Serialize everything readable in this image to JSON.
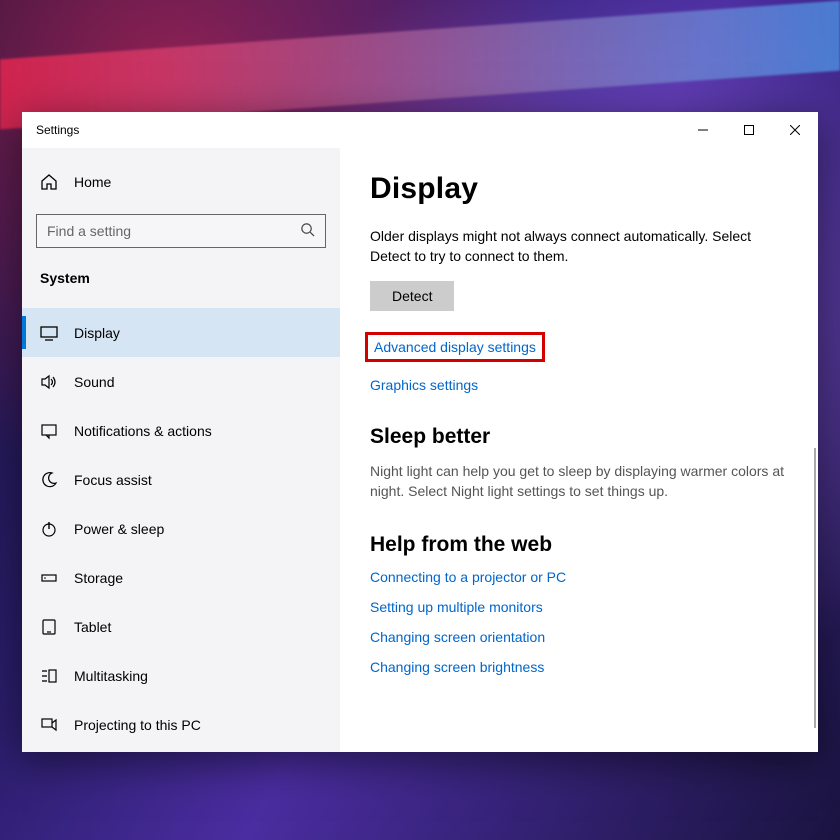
{
  "window": {
    "title": "Settings"
  },
  "sidebar": {
    "home": "Home",
    "search_placeholder": "Find a setting",
    "section": "System",
    "items": [
      {
        "label": "Display",
        "icon": "monitor",
        "selected": true
      },
      {
        "label": "Sound",
        "icon": "sound"
      },
      {
        "label": "Notifications & actions",
        "icon": "notification"
      },
      {
        "label": "Focus assist",
        "icon": "moon"
      },
      {
        "label": "Power & sleep",
        "icon": "power"
      },
      {
        "label": "Storage",
        "icon": "storage"
      },
      {
        "label": "Tablet",
        "icon": "tablet"
      },
      {
        "label": "Multitasking",
        "icon": "multitask"
      },
      {
        "label": "Projecting to this PC",
        "icon": "project"
      }
    ]
  },
  "main": {
    "heading": "Display",
    "older_text": "Older displays might not always connect automatically. Select Detect to try to connect to them.",
    "detect": "Detect",
    "adv_link": "Advanced display settings",
    "gfx_link": "Graphics settings",
    "sleep_heading": "Sleep better",
    "sleep_desc": "Night light can help you get to sleep by displaying warmer colors at night. Select Night light settings to set things up.",
    "web_heading": "Help from the web",
    "web_links": [
      "Connecting to a projector or PC",
      "Setting up multiple monitors",
      "Changing screen orientation",
      "Changing screen brightness"
    ]
  }
}
